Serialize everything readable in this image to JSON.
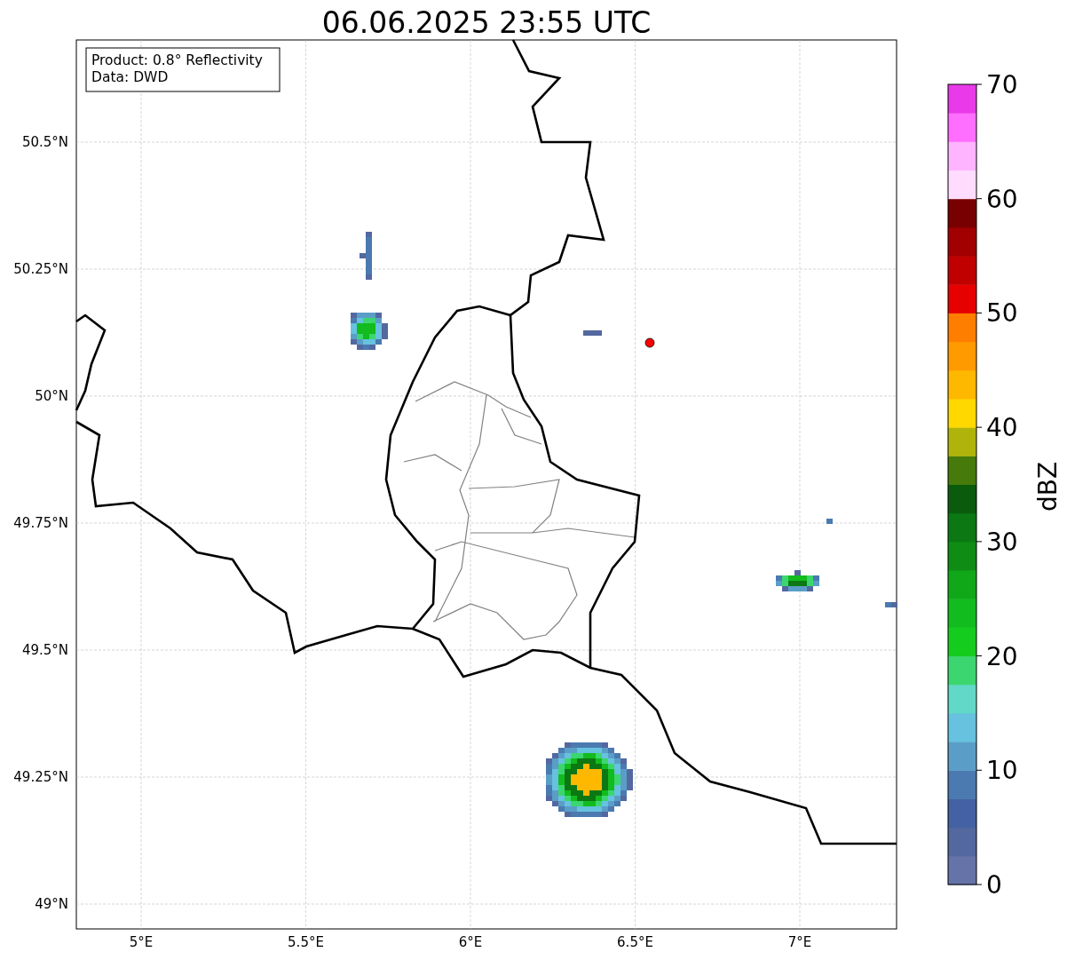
{
  "title": "06.06.2025 23:55 UTC",
  "info_box": {
    "lines": [
      "Product: 0.8° Reflectivity",
      "Data: DWD"
    ]
  },
  "map": {
    "y_ticks": [
      "50.5°N",
      "50.25°N",
      "50°N",
      "49.75°N",
      "49.5°N",
      "49.25°N",
      "49°N"
    ],
    "x_ticks": [
      "5°E",
      "5.5°E",
      "6°E",
      "6.5°E",
      "7°E"
    ]
  },
  "colorbar": {
    "label": "dBZ",
    "ticks": [
      "70",
      "60",
      "50",
      "40",
      "30",
      "20",
      "10",
      "0"
    ],
    "bands": [
      {
        "color": "#6673a8"
      },
      {
        "color": "#5468a0"
      },
      {
        "color": "#4461a3"
      },
      {
        "color": "#4a7ab0"
      },
      {
        "color": "#5a9ec8"
      },
      {
        "color": "#66c2de"
      },
      {
        "color": "#62d8c8"
      },
      {
        "color": "#3cd670"
      },
      {
        "color": "#14cc1e"
      },
      {
        "color": "#12bb1e"
      },
      {
        "color": "#10a818"
      },
      {
        "color": "#0e8c14"
      },
      {
        "color": "#0c7814"
      },
      {
        "color": "#0a5c0c"
      },
      {
        "color": "#467a0a"
      },
      {
        "color": "#b0b40a"
      },
      {
        "color": "#ffd800"
      },
      {
        "color": "#ffb800"
      },
      {
        "color": "#ff9a00"
      },
      {
        "color": "#ff7e00"
      },
      {
        "color": "#e60000"
      },
      {
        "color": "#c00000"
      },
      {
        "color": "#a00000"
      },
      {
        "color": "#780000"
      },
      {
        "color": "#ffdcff"
      },
      {
        "color": "#ffb4ff"
      },
      {
        "color": "#ff6eff"
      },
      {
        "color": "#e83ae8"
      }
    ]
  }
}
